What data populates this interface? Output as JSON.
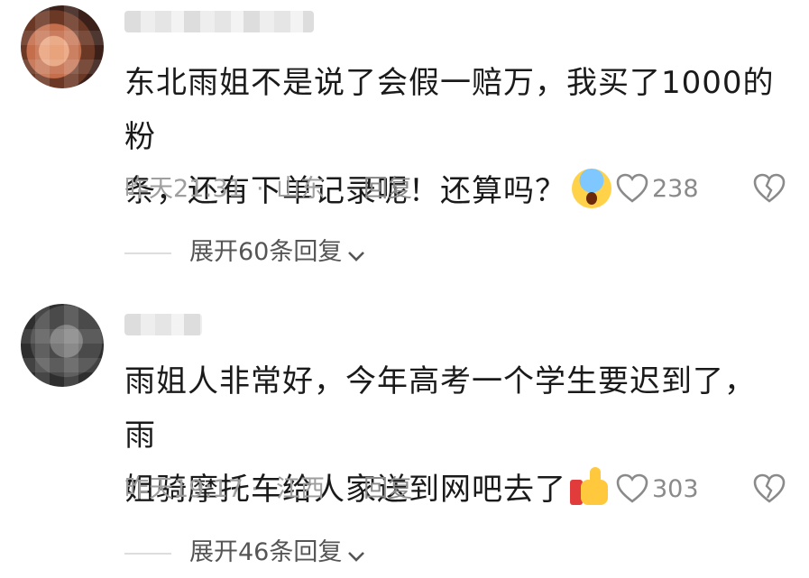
{
  "comments": [
    {
      "username": "",
      "text_line1": "东北雨姐不是说了会假一赔万，我买了1000的粉",
      "text_line2": "条，还有下单记录呢！还算吗？",
      "emoji": "screaming-face",
      "time": "昨天21:31",
      "separator": "·",
      "region": "山东",
      "reply_label": "回复",
      "likes": "238",
      "expand_label": "展开60条回复"
    },
    {
      "username": "",
      "text_line1": "雨姐人非常好，今年高考一个学生要迟到了，雨",
      "text_line2": "姐骑摩托车给人家送到网吧去了",
      "emoji": "thumbs-up",
      "time": "昨天19:17",
      "separator": "·",
      "region": "江西",
      "reply_label": "回复",
      "likes": "303",
      "expand_label": "展开46条回复"
    }
  ],
  "colors": {
    "text": "#1a1a1a",
    "meta": "#9e9e9e",
    "expand": "#555555"
  }
}
